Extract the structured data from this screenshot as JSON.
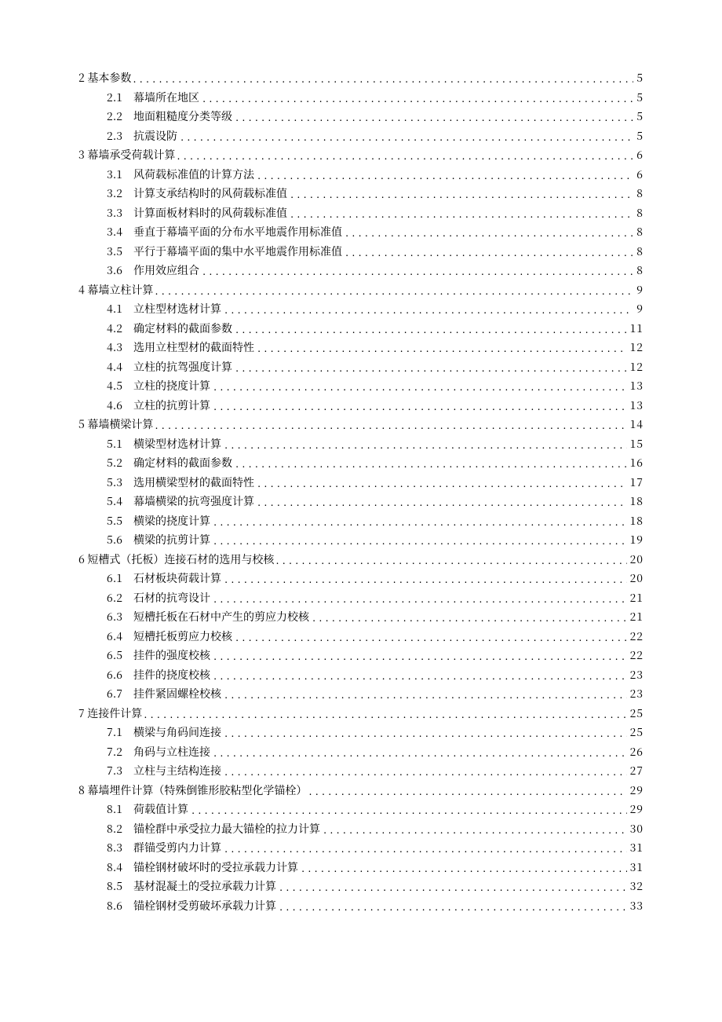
{
  "toc": [
    {
      "type": "section",
      "num": "2",
      "title": "基本参数",
      "page": "5"
    },
    {
      "type": "sub",
      "num": "2.1",
      "title": "幕墙所在地区",
      "page": "5"
    },
    {
      "type": "sub",
      "num": "2.2",
      "title": "地面粗糙度分类等级",
      "page": "5"
    },
    {
      "type": "sub",
      "num": "2.3",
      "title": "抗震设防",
      "page": "5"
    },
    {
      "type": "section",
      "num": "3",
      "title": "幕墙承受荷载计算",
      "page": "6"
    },
    {
      "type": "sub",
      "num": "3.1",
      "title": "风荷载标准值的计算方法",
      "page": "6"
    },
    {
      "type": "sub",
      "num": "3.2",
      "title": "计算支承结构时的风荷载标准值",
      "page": "8"
    },
    {
      "type": "sub",
      "num": "3.3",
      "title": "计算面板材料时的风荷载标准值",
      "page": "8"
    },
    {
      "type": "sub",
      "num": "3.4",
      "title": "垂直于幕墙平面的分布水平地震作用标准值",
      "page": "8"
    },
    {
      "type": "sub",
      "num": "3.5",
      "title": "平行于幕墙平面的集中水平地震作用标准值",
      "page": "8"
    },
    {
      "type": "sub",
      "num": "3.6",
      "title": "作用效应组合",
      "page": "8"
    },
    {
      "type": "section",
      "num": "4",
      "title": "幕墙立柱计算",
      "page": "9"
    },
    {
      "type": "sub",
      "num": "4.1",
      "title": "立柱型材选材计算",
      "page": "9"
    },
    {
      "type": "sub",
      "num": "4.2",
      "title": "确定材料的截面参数",
      "page": "11"
    },
    {
      "type": "sub",
      "num": "4.3",
      "title": "选用立柱型材的截面特性",
      "page": "12"
    },
    {
      "type": "sub",
      "num": "4.4",
      "title": "立柱的抗驾强度计算",
      "page": "12"
    },
    {
      "type": "sub",
      "num": "4.5",
      "title": "立柱的挠度计算",
      "page": "13"
    },
    {
      "type": "sub",
      "num": "4.6",
      "title": "立柱的抗剪计算",
      "page": "13"
    },
    {
      "type": "section",
      "num": "5",
      "title": "幕墙横梁计算",
      "page": "14"
    },
    {
      "type": "sub",
      "num": "5.1",
      "title": "横梁型材选材计算",
      "page": "15"
    },
    {
      "type": "sub",
      "num": "5.2",
      "title": "确定材料的截面参数",
      "page": "16"
    },
    {
      "type": "sub",
      "num": "5.3",
      "title": "选用横梁型材的截面特性",
      "page": "17"
    },
    {
      "type": "sub",
      "num": "5.4",
      "title": "幕墙横梁的抗弯强度计算",
      "page": "18"
    },
    {
      "type": "sub",
      "num": "5.5",
      "title": "横梁的挠度计算",
      "page": "18"
    },
    {
      "type": "sub",
      "num": "5.6",
      "title": "横梁的抗剪计算",
      "page": "19"
    },
    {
      "type": "section",
      "num": "6",
      "title": "短槽式（托板）连接石材的选用与校核",
      "page": "20"
    },
    {
      "type": "sub",
      "num": "6.1",
      "title": "石材板块荷载计算",
      "page": "20"
    },
    {
      "type": "sub",
      "num": "6.2",
      "title": "石材的抗弯设计",
      "page": "21"
    },
    {
      "type": "sub",
      "num": "6.3",
      "title": "短槽托板在石材中产生的剪应力校核",
      "page": "21"
    },
    {
      "type": "sub",
      "num": "6.4",
      "title": "短槽托板剪应力校核",
      "page": "22"
    },
    {
      "type": "sub",
      "num": "6.5",
      "title": "挂件的强度校核",
      "page": "22"
    },
    {
      "type": "sub",
      "num": "6.6",
      "title": "挂件的挠度校核",
      "page": "23"
    },
    {
      "type": "sub",
      "num": "6.7",
      "title": "挂件紧固螺栓校核",
      "page": "23"
    },
    {
      "type": "section",
      "num": "7",
      "title": "连接件计算",
      "page": "25"
    },
    {
      "type": "sub",
      "num": "7.1",
      "title": "横梁与角码间连接",
      "page": "25"
    },
    {
      "type": "sub",
      "num": "7.2",
      "title": "角码与立柱连接",
      "page": "26"
    },
    {
      "type": "sub",
      "num": "7.3",
      "title": "立柱与主结构连接",
      "page": "27"
    },
    {
      "type": "section",
      "num": "8",
      "title": "幕墙埋件计算（特殊倒锥形胶粘型化学锚栓）",
      "page": "29"
    },
    {
      "type": "sub",
      "num": "8.1",
      "title": "荷载值计算",
      "page": "29"
    },
    {
      "type": "sub",
      "num": "8.2",
      "title": "锚栓群中承受拉力最大锚栓的拉力计算",
      "page": "30"
    },
    {
      "type": "sub",
      "num": "8.3",
      "title": "群锚受剪内力计算",
      "page": "31"
    },
    {
      "type": "sub",
      "num": "8.4",
      "title": "锚栓钢材破坏时的受拉承载力计算",
      "page": "31"
    },
    {
      "type": "sub",
      "num": "8.5",
      "title": "基材混凝土的受拉承载力计算",
      "page": "32"
    },
    {
      "type": "sub",
      "num": "8.6",
      "title": "锚栓钢材受剪破坏承载力计算",
      "page": "33"
    }
  ]
}
